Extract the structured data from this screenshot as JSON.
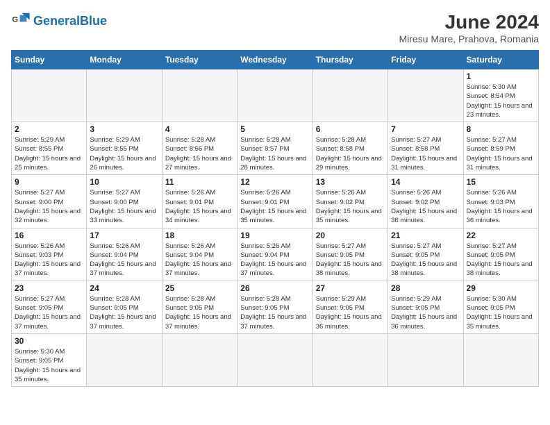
{
  "header": {
    "logo_text_regular": "General",
    "logo_text_blue": "Blue",
    "title": "June 2024",
    "subtitle": "Miresu Mare, Prahova, Romania"
  },
  "days_of_week": [
    "Sunday",
    "Monday",
    "Tuesday",
    "Wednesday",
    "Thursday",
    "Friday",
    "Saturday"
  ],
  "weeks": [
    [
      {
        "day": "",
        "info": ""
      },
      {
        "day": "",
        "info": ""
      },
      {
        "day": "",
        "info": ""
      },
      {
        "day": "",
        "info": ""
      },
      {
        "day": "",
        "info": ""
      },
      {
        "day": "",
        "info": ""
      },
      {
        "day": "1",
        "info": "Sunrise: 5:30 AM\nSunset: 8:54 PM\nDaylight: 15 hours\nand 23 minutes."
      }
    ],
    [
      {
        "day": "2",
        "info": "Sunrise: 5:29 AM\nSunset: 8:55 PM\nDaylight: 15 hours\nand 25 minutes."
      },
      {
        "day": "3",
        "info": "Sunrise: 5:29 AM\nSunset: 8:55 PM\nDaylight: 15 hours\nand 26 minutes."
      },
      {
        "day": "4",
        "info": "Sunrise: 5:28 AM\nSunset: 8:56 PM\nDaylight: 15 hours\nand 27 minutes."
      },
      {
        "day": "5",
        "info": "Sunrise: 5:28 AM\nSunset: 8:57 PM\nDaylight: 15 hours\nand 28 minutes."
      },
      {
        "day": "6",
        "info": "Sunrise: 5:28 AM\nSunset: 8:58 PM\nDaylight: 15 hours\nand 29 minutes."
      },
      {
        "day": "7",
        "info": "Sunrise: 5:27 AM\nSunset: 8:58 PM\nDaylight: 15 hours\nand 31 minutes."
      },
      {
        "day": "8",
        "info": "Sunrise: 5:27 AM\nSunset: 8:59 PM\nDaylight: 15 hours\nand 31 minutes."
      }
    ],
    [
      {
        "day": "9",
        "info": "Sunrise: 5:27 AM\nSunset: 9:00 PM\nDaylight: 15 hours\nand 32 minutes."
      },
      {
        "day": "10",
        "info": "Sunrise: 5:27 AM\nSunset: 9:00 PM\nDaylight: 15 hours\nand 33 minutes."
      },
      {
        "day": "11",
        "info": "Sunrise: 5:26 AM\nSunset: 9:01 PM\nDaylight: 15 hours\nand 34 minutes."
      },
      {
        "day": "12",
        "info": "Sunrise: 5:26 AM\nSunset: 9:01 PM\nDaylight: 15 hours\nand 35 minutes."
      },
      {
        "day": "13",
        "info": "Sunrise: 5:26 AM\nSunset: 9:02 PM\nDaylight: 15 hours\nand 35 minutes."
      },
      {
        "day": "14",
        "info": "Sunrise: 5:26 AM\nSunset: 9:02 PM\nDaylight: 15 hours\nand 36 minutes."
      },
      {
        "day": "15",
        "info": "Sunrise: 5:26 AM\nSunset: 9:03 PM\nDaylight: 15 hours\nand 36 minutes."
      }
    ],
    [
      {
        "day": "16",
        "info": "Sunrise: 5:26 AM\nSunset: 9:03 PM\nDaylight: 15 hours\nand 37 minutes."
      },
      {
        "day": "17",
        "info": "Sunrise: 5:26 AM\nSunset: 9:04 PM\nDaylight: 15 hours\nand 37 minutes."
      },
      {
        "day": "18",
        "info": "Sunrise: 5:26 AM\nSunset: 9:04 PM\nDaylight: 15 hours\nand 37 minutes."
      },
      {
        "day": "19",
        "info": "Sunrise: 5:26 AM\nSunset: 9:04 PM\nDaylight: 15 hours\nand 37 minutes."
      },
      {
        "day": "20",
        "info": "Sunrise: 5:27 AM\nSunset: 9:05 PM\nDaylight: 15 hours\nand 38 minutes."
      },
      {
        "day": "21",
        "info": "Sunrise: 5:27 AM\nSunset: 9:05 PM\nDaylight: 15 hours\nand 38 minutes."
      },
      {
        "day": "22",
        "info": "Sunrise: 5:27 AM\nSunset: 9:05 PM\nDaylight: 15 hours\nand 38 minutes."
      }
    ],
    [
      {
        "day": "23",
        "info": "Sunrise: 5:27 AM\nSunset: 9:05 PM\nDaylight: 15 hours\nand 37 minutes."
      },
      {
        "day": "24",
        "info": "Sunrise: 5:28 AM\nSunset: 9:05 PM\nDaylight: 15 hours\nand 37 minutes."
      },
      {
        "day": "25",
        "info": "Sunrise: 5:28 AM\nSunset: 9:05 PM\nDaylight: 15 hours\nand 37 minutes."
      },
      {
        "day": "26",
        "info": "Sunrise: 5:28 AM\nSunset: 9:05 PM\nDaylight: 15 hours\nand 37 minutes."
      },
      {
        "day": "27",
        "info": "Sunrise: 5:29 AM\nSunset: 9:05 PM\nDaylight: 15 hours\nand 36 minutes."
      },
      {
        "day": "28",
        "info": "Sunrise: 5:29 AM\nSunset: 9:05 PM\nDaylight: 15 hours\nand 36 minutes."
      },
      {
        "day": "29",
        "info": "Sunrise: 5:30 AM\nSunset: 9:05 PM\nDaylight: 15 hours\nand 35 minutes."
      }
    ],
    [
      {
        "day": "30",
        "info": "Sunrise: 5:30 AM\nSunset: 9:05 PM\nDaylight: 15 hours\nand 35 minutes."
      },
      {
        "day": "",
        "info": ""
      },
      {
        "day": "",
        "info": ""
      },
      {
        "day": "",
        "info": ""
      },
      {
        "day": "",
        "info": ""
      },
      {
        "day": "",
        "info": ""
      },
      {
        "day": "",
        "info": ""
      }
    ]
  ]
}
